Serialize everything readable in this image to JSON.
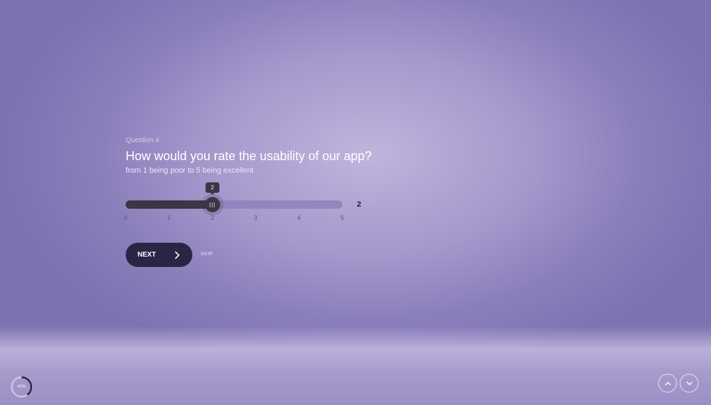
{
  "question": {
    "number_label": "Question 4",
    "title": "How would you rate the usability of our app?",
    "subtitle": "from 1 being poor to 5 being excellent"
  },
  "slider": {
    "min": 0,
    "max": 5,
    "value": 2,
    "value_text": "2",
    "ticks": [
      "0",
      "1",
      "2",
      "3",
      "4",
      "5"
    ]
  },
  "actions": {
    "next_label": "NEXT",
    "skip_label": "SKIP"
  },
  "progress": {
    "percent": 40,
    "label": "40%"
  },
  "icons": {
    "next": "chevron-right-icon",
    "previous_question": "chevron-up-icon",
    "next_question": "chevron-down-icon"
  },
  "colors": {
    "background": "#a598cc",
    "button": "#2a2545",
    "slider_fill": "#3a3646"
  }
}
